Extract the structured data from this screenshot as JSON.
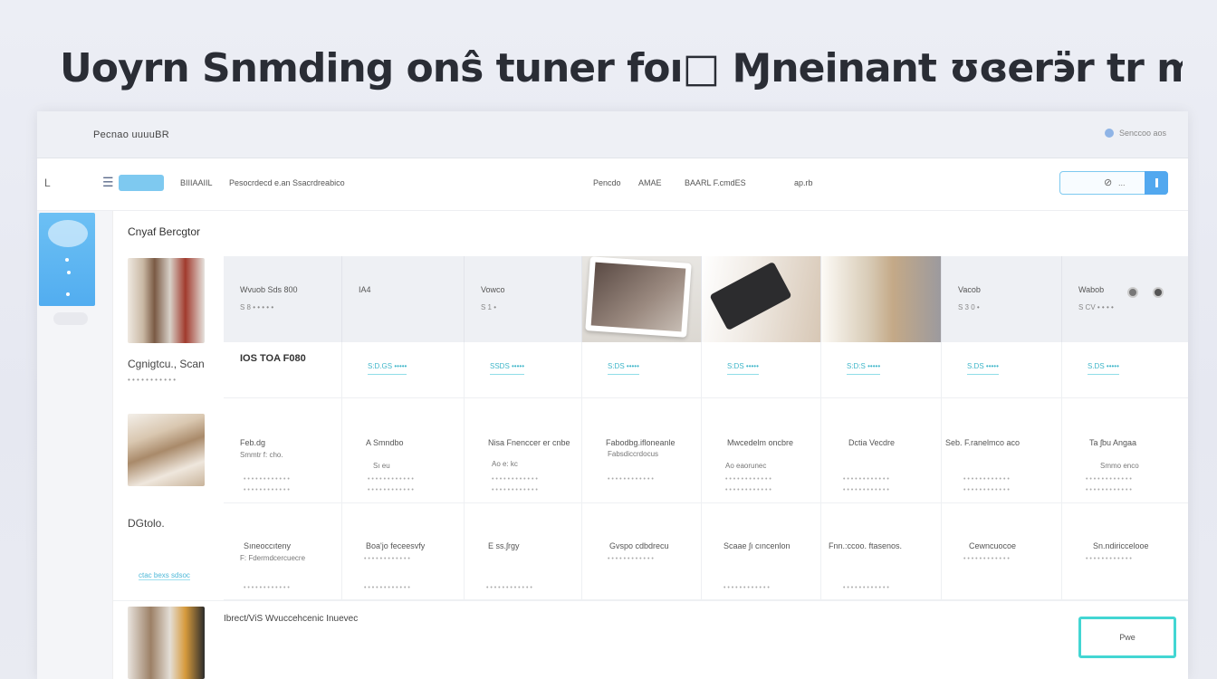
{
  "headline": "Uoyrn Snmding onŝ tuner foı□ Ɱneinant ʊɞerӭr tr moeɕɒn",
  "topbar": {
    "brand": "Pecnao uuuuBR",
    "right_text": "Senccoo  aos"
  },
  "toolbar": {
    "back": "L",
    "menu_glyph": "☰",
    "items": [
      "BIIIAAIIL",
      "Pesocrdecd e.an  Ssacrdreabico",
      "Pencdo",
      "AMAE",
      "BAARL F.cmdES",
      "ap.rb"
    ],
    "search_placeholder": "..."
  },
  "content": {
    "section_title": "Cnyaf Bercgtor",
    "side": [
      {
        "label": "Cgnigtcu., Scan",
        "sub": "• • • • • • • • • • •"
      },
      {
        "label": "DGtolo.",
        "link": "ctac bexs sdsoc"
      }
    ],
    "bottom_label": "Ibrect/ViS  Wvuccehcenic Inuevec",
    "cta_label": "Pwe"
  },
  "grid": {
    "header": [
      {
        "t1": "Wvuob   Sds   800",
        "t2": "S 8 •       • • • •",
        "extra": "IA4"
      },
      {
        "t1": "Vowco",
        "t2": "S 1 •"
      },
      {
        "t1": "",
        "t2": ""
      },
      {
        "t1": "",
        "t2": ""
      },
      {
        "t1": "Vacob",
        "t2": "S 3 0 •"
      },
      {
        "t1": "Wabob",
        "t2": "S CV     • • • •"
      }
    ],
    "prices": [
      "IOS TOA F080",
      "S:D.GS  •••••",
      "SSDS  •••••",
      "S:DS  •••••",
      "S:DS  •••••",
      "S:D:S  •••••",
      "S.DS  •••••",
      "S.DS  •••••"
    ],
    "row2": [
      [
        "Feb.dg",
        "Smmtr f: cho."
      ],
      [
        "A  Smndbo",
        "Sı  eu"
      ],
      [
        "Nisa  Fnenccer er cnbe",
        "Ao  e:  kc"
      ],
      [
        "Fabodbg.ifloneanle",
        "Fabsdiccrdocus"
      ],
      [
        "Mwcedelm oncbre",
        "Ao  eaorunec"
      ],
      [
        "Dctia Vecdre",
        ""
      ],
      [
        "Seb. F.ranelmco aco",
        ""
      ],
      [
        "Ta  ʃbu Angaa",
        "Smmo  enco"
      ]
    ],
    "row3": [
      [
        "Sıneoccıteny",
        "F: Fdermdcercuecre"
      ],
      [
        "Boa'jo feceesvfy",
        ""
      ],
      [
        "E  ss.ʃrgy",
        ""
      ],
      [
        "Gvspo  cdbdrecu",
        ""
      ],
      [
        "Scaae ʃı cıncenlon",
        ""
      ],
      [
        "Fnn.:ccoo. ftasenos.",
        ""
      ],
      [
        "Cewncuocoe",
        ""
      ],
      [
        "Sn.ndiriccelooe",
        ""
      ]
    ],
    "filler": "• • • • • • • • • • • •"
  }
}
